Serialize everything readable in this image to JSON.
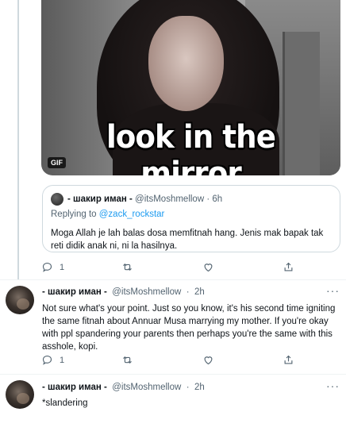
{
  "media": {
    "caption": "look in the mirror",
    "badge": "GIF"
  },
  "quoted": {
    "name": "- шакир иман -",
    "handle": "@itsMoshmellow",
    "sep": "·",
    "time": "6h",
    "replying_prefix": "Replying to",
    "replying_to": "@zack_rockstar",
    "text": "Moga Allah je lah balas dosa memfitnah hang. Jenis mak bapak tak reti didik anak ni, ni la hasilnya."
  },
  "parent_actions": {
    "reply_count": "1"
  },
  "tweets": [
    {
      "name": "- шакир иман -",
      "handle": "@itsMoshmellow",
      "sep": "·",
      "time": "2h",
      "more": "···",
      "text": "Not sure what's your point. Just so you know, it's his second time igniting the same fitnah about Annuar Musa marrying my mother. If you're okay with ppl spandering your parents then perhaps you're the same with this asshole, kopi.",
      "reply_count": "1"
    },
    {
      "name": "- шакир иман -",
      "handle": "@itsMoshmellow",
      "sep": "·",
      "time": "2h",
      "more": "···",
      "text": "*slandering"
    }
  ],
  "colors": {
    "accent": "#1d9bf0",
    "muted": "#536471",
    "border": "#cfd9de"
  },
  "icons": [
    "reply-icon",
    "retweet-icon",
    "like-icon",
    "share-icon",
    "more-icon"
  ]
}
